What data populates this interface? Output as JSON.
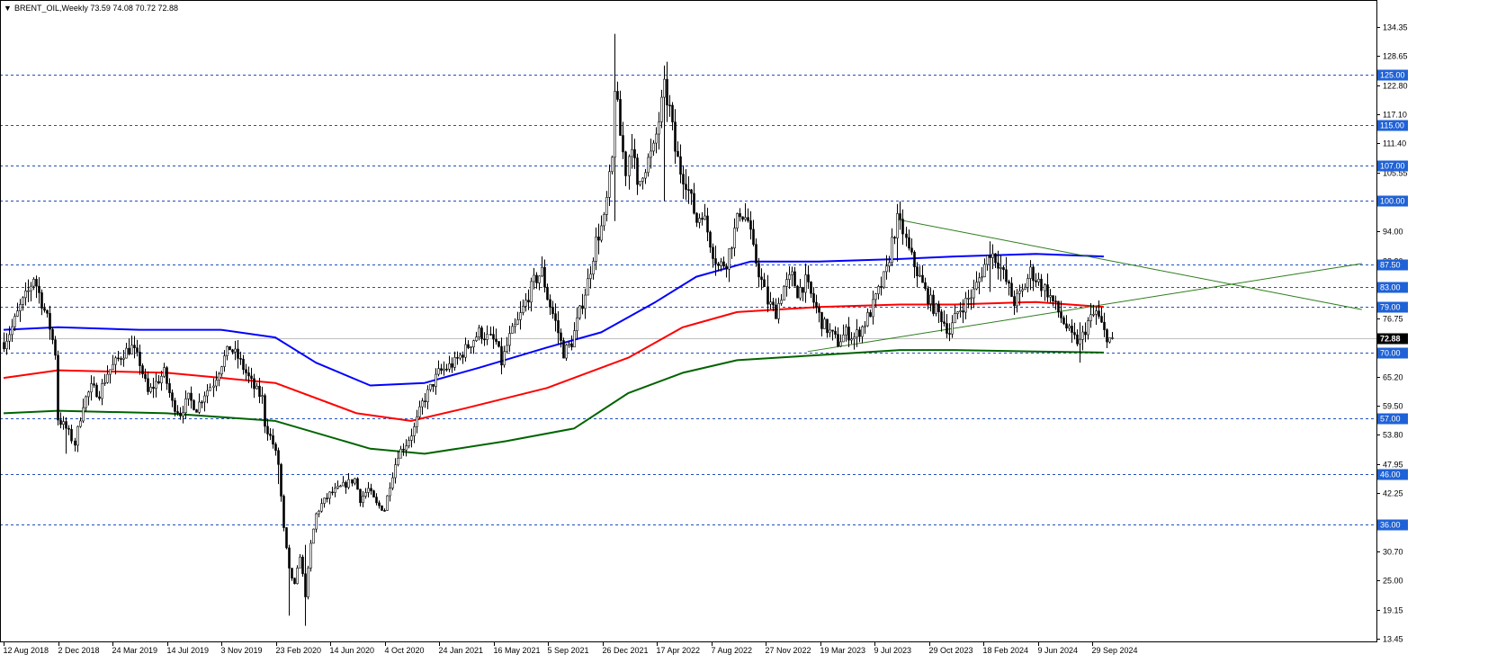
{
  "header": {
    "menu_arrow": "▼",
    "symbol": "BRENT_OIL",
    "timeframe": "Weekly",
    "ohlc": "73.59 74.08 70.72 72.88"
  },
  "colors": {
    "background": "#ffffff",
    "candle": "#000000",
    "ma_fast": "#0000ff",
    "ma_mid": "#ff0000",
    "ma_slow": "#006400",
    "level_line": "#1f4fbf",
    "level_label_bg": "#1f62d6",
    "trendline": "#2e7d1e",
    "price_label_bg": "#000000"
  },
  "chart_data": {
    "type": "candlestick",
    "title": "BRENT_OIL,Weekly",
    "ylim": [
      13.45,
      137.5
    ],
    "y_ticks": [
      "134.35",
      "128.65",
      "122.80",
      "117.10",
      "111.40",
      "105.55",
      "100.00",
      "94.00",
      "88.20",
      "82.50",
      "76.75",
      "72.88",
      "70.00",
      "65.20",
      "59.50",
      "53.80",
      "47.95",
      "42.25",
      "36.00",
      "30.70",
      "25.00",
      "19.15",
      "13.45"
    ],
    "x_ticks": [
      "12 Aug 2018",
      "2 Dec 2018",
      "24 Mar 2019",
      "14 Jul 2019",
      "3 Nov 2019",
      "23 Feb 2020",
      "14 Jun 2020",
      "4 Oct 2020",
      "24 Jan 2021",
      "16 May 2021",
      "5 Sep 2021",
      "26 Dec 2021",
      "17 Apr 2022",
      "7 Aug 2022",
      "27 Nov 2022",
      "19 Mar 2023",
      "9 Jul 2023",
      "29 Oct 2023",
      "18 Feb 2024",
      "9 Jun 2024",
      "29 Sep 2024"
    ],
    "last_price": 72.88,
    "horizontal_levels": [
      {
        "price": 125.0,
        "label": "125.00"
      },
      {
        "price": 115.0,
        "label": "115.00"
      },
      {
        "price": 107.0,
        "label": "107.00"
      },
      {
        "price": 100.0,
        "label": "100.00"
      },
      {
        "price": 87.5,
        "label": "87.50"
      },
      {
        "price": 83.0,
        "label": "83.00"
      },
      {
        "price": 79.0,
        "label": "79.00"
      },
      {
        "price": 70.0,
        "label": "70.00"
      },
      {
        "price": 57.0,
        "label": "57.00"
      },
      {
        "price": 46.0,
        "label": "46.00"
      },
      {
        "price": 36.0,
        "label": "36.00"
      }
    ],
    "close_path": [
      [
        0,
        72
      ],
      [
        3,
        75
      ],
      [
        6,
        79
      ],
      [
        9,
        82
      ],
      [
        11,
        85
      ],
      [
        14,
        80
      ],
      [
        17,
        75
      ],
      [
        19,
        70
      ],
      [
        20,
        57
      ],
      [
        23,
        55
      ],
      [
        26,
        52
      ],
      [
        29,
        60
      ],
      [
        32,
        63
      ],
      [
        35,
        62
      ],
      [
        38,
        66
      ],
      [
        41,
        68
      ],
      [
        44,
        70
      ],
      [
        47,
        71
      ],
      [
        50,
        68
      ],
      [
        53,
        62
      ],
      [
        56,
        64
      ],
      [
        59,
        66
      ],
      [
        62,
        60
      ],
      [
        65,
        58
      ],
      [
        68,
        61
      ],
      [
        71,
        59
      ],
      [
        74,
        62
      ],
      [
        77,
        64
      ],
      [
        80,
        68
      ],
      [
        83,
        71
      ],
      [
        86,
        69
      ],
      [
        89,
        66
      ],
      [
        92,
        63
      ],
      [
        95,
        61
      ],
      [
        96,
        56
      ],
      [
        99,
        52
      ],
      [
        101,
        48
      ],
      [
        103,
        35
      ],
      [
        105,
        27
      ],
      [
        107,
        24
      ],
      [
        109,
        30
      ],
      [
        111,
        22
      ],
      [
        113,
        32
      ],
      [
        115,
        38
      ],
      [
        117,
        40
      ],
      [
        120,
        42
      ],
      [
        123,
        43
      ],
      [
        126,
        44
      ],
      [
        129,
        45
      ],
      [
        131,
        41
      ],
      [
        134,
        43
      ],
      [
        137,
        40
      ],
      [
        140,
        39
      ],
      [
        142,
        44
      ],
      [
        145,
        50
      ],
      [
        148,
        52
      ],
      [
        151,
        55
      ],
      [
        154,
        60
      ],
      [
        157,
        63
      ],
      [
        160,
        66
      ],
      [
        163,
        67
      ],
      [
        166,
        68
      ],
      [
        169,
        70
      ],
      [
        172,
        72
      ],
      [
        175,
        74
      ],
      [
        178,
        73
      ],
      [
        181,
        72
      ],
      [
        183,
        68
      ],
      [
        186,
        73
      ],
      [
        189,
        76
      ],
      [
        192,
        80
      ],
      [
        195,
        84
      ],
      [
        198,
        86
      ],
      [
        200,
        81
      ],
      [
        203,
        76
      ],
      [
        206,
        70
      ],
      [
        209,
        72
      ],
      [
        212,
        78
      ],
      [
        215,
        84
      ],
      [
        218,
        92
      ],
      [
        221,
        96
      ],
      [
        224,
        108
      ],
      [
        225,
        123
      ],
      [
        227,
        113
      ],
      [
        229,
        106
      ],
      [
        231,
        112
      ],
      [
        233,
        102
      ],
      [
        235,
        106
      ],
      [
        237,
        108
      ],
      [
        239,
        110
      ],
      [
        241,
        116
      ],
      [
        243,
        122
      ],
      [
        245,
        118
      ],
      [
        247,
        110
      ],
      [
        249,
        106
      ],
      [
        251,
        104
      ],
      [
        253,
        100
      ],
      [
        255,
        96
      ],
      [
        257,
        98
      ],
      [
        259,
        94
      ],
      [
        261,
        90
      ],
      [
        263,
        87
      ],
      [
        266,
        88
      ],
      [
        269,
        94
      ],
      [
        271,
        98
      ],
      [
        274,
        96
      ],
      [
        276,
        90
      ],
      [
        279,
        84
      ],
      [
        281,
        80
      ],
      [
        284,
        78
      ],
      [
        287,
        83
      ],
      [
        290,
        85
      ],
      [
        292,
        82
      ],
      [
        295,
        84
      ],
      [
        298,
        80
      ],
      [
        301,
        76
      ],
      [
        304,
        74
      ],
      [
        307,
        72
      ],
      [
        310,
        74
      ],
      [
        313,
        73
      ],
      [
        316,
        75
      ],
      [
        319,
        78
      ],
      [
        322,
        82
      ],
      [
        325,
        86
      ],
      [
        327,
        92
      ],
      [
        329,
        96
      ],
      [
        331,
        94
      ],
      [
        333,
        90
      ],
      [
        336,
        86
      ],
      [
        339,
        82
      ],
      [
        342,
        79
      ],
      [
        345,
        77
      ],
      [
        348,
        74
      ],
      [
        351,
        78
      ],
      [
        354,
        80
      ],
      [
        357,
        82
      ],
      [
        360,
        86
      ],
      [
        363,
        90
      ],
      [
        366,
        88
      ],
      [
        369,
        84
      ],
      [
        372,
        80
      ],
      [
        375,
        82
      ],
      [
        378,
        86
      ],
      [
        381,
        84
      ],
      [
        384,
        82
      ],
      [
        387,
        79
      ],
      [
        390,
        76
      ],
      [
        393,
        73
      ],
      [
        396,
        72
      ],
      [
        399,
        76
      ],
      [
        402,
        78
      ],
      [
        405,
        74
      ],
      [
        408,
        72
      ]
    ],
    "wick_spikes": [
      {
        "x": 23,
        "high": 56,
        "low": 50
      },
      {
        "x": 101,
        "high": 50,
        "low": 44
      },
      {
        "x": 105,
        "high": 32,
        "low": 18
      },
      {
        "x": 111,
        "high": 32,
        "low": 16
      },
      {
        "x": 225,
        "high": 133,
        "low": 96
      },
      {
        "x": 243,
        "high": 125,
        "low": 100
      },
      {
        "x": 329,
        "high": 97,
        "low": 88
      },
      {
        "x": 363,
        "high": 92,
        "low": 82
      },
      {
        "x": 396,
        "high": 76,
        "low": 68
      }
    ],
    "series": [
      {
        "name": "",
        "values": [
          [
            0,
            74.5
          ],
          [
            20,
            75
          ],
          [
            50,
            74.5
          ],
          [
            80,
            74.5
          ],
          [
            100,
            73
          ],
          [
            115,
            68
          ],
          [
            135,
            63.5
          ],
          [
            155,
            64
          ],
          [
            175,
            67
          ],
          [
            200,
            71
          ],
          [
            220,
            74
          ],
          [
            240,
            80
          ],
          [
            255,
            85
          ],
          [
            275,
            88
          ],
          [
            300,
            88
          ],
          [
            330,
            88.5
          ],
          [
            350,
            89
          ],
          [
            380,
            89.5
          ],
          [
            405,
            89
          ]
        ]
      },
      {
        "name": "",
        "values": [
          [
            0,
            65
          ],
          [
            20,
            66.5
          ],
          [
            60,
            66
          ],
          [
            100,
            64
          ],
          [
            130,
            58
          ],
          [
            150,
            56.5
          ],
          [
            170,
            59
          ],
          [
            200,
            63
          ],
          [
            230,
            69
          ],
          [
            250,
            75
          ],
          [
            270,
            78
          ],
          [
            300,
            79
          ],
          [
            330,
            79.5
          ],
          [
            350,
            79.5
          ],
          [
            380,
            80
          ],
          [
            405,
            79
          ]
        ]
      },
      {
        "name": "",
        "values": [
          [
            0,
            58
          ],
          [
            20,
            58.5
          ],
          [
            60,
            58
          ],
          [
            100,
            56.5
          ],
          [
            135,
            51
          ],
          [
            155,
            50
          ],
          [
            185,
            52.5
          ],
          [
            210,
            55
          ],
          [
            230,
            62
          ],
          [
            250,
            66
          ],
          [
            270,
            68.5
          ],
          [
            300,
            69.5
          ],
          [
            330,
            70.5
          ],
          [
            350,
            70.5
          ],
          [
            380,
            70.2
          ],
          [
            405,
            70
          ]
        ]
      }
    ],
    "trendlines": [
      {
        "from": [
          329,
          96.3
        ],
        "to": [
          500,
          78.5
        ]
      },
      {
        "from": [
          296,
          70.2
        ],
        "to": [
          500,
          87.6
        ]
      }
    ]
  }
}
